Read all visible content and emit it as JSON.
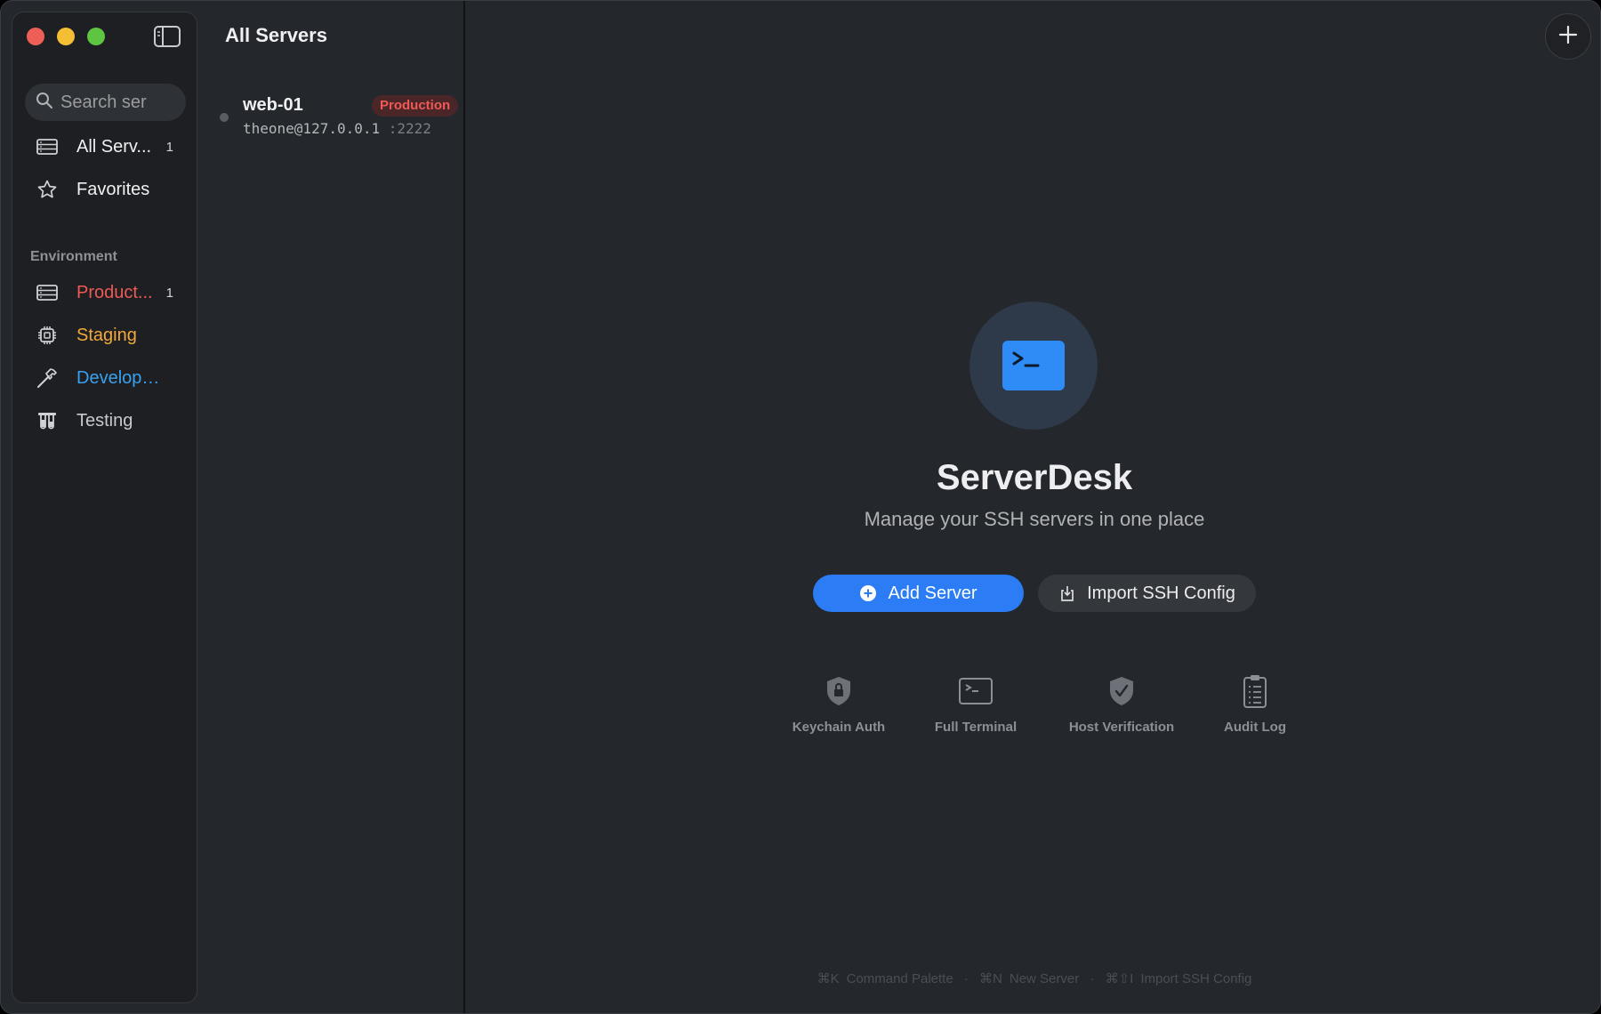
{
  "sidebar": {
    "search_placeholder": "Search ser",
    "items": [
      {
        "label": "All Serv...",
        "count": "1"
      },
      {
        "label": "Favorites"
      }
    ],
    "section_title": "Environment",
    "env_items": [
      {
        "label": "Product...",
        "count": "1",
        "color": "#ef5a55"
      },
      {
        "label": "Staging",
        "color": "#f2a93b"
      },
      {
        "label": "Developm...",
        "color": "#3aa0f0"
      },
      {
        "label": "Testing",
        "color": "#c8c9cc"
      }
    ]
  },
  "list": {
    "title": "All Servers",
    "servers": [
      {
        "name": "web-01",
        "badge": "Production",
        "address": "theone@127.0.0.1",
        "port": ":2222"
      }
    ]
  },
  "main": {
    "app_name": "ServerDesk",
    "tagline": "Manage your SSH servers in one place",
    "add_button": "Add Server",
    "import_button": "Import SSH Config",
    "features": [
      {
        "label": "Keychain Auth",
        "icon": "lock-shield-icon"
      },
      {
        "label": "Full Terminal",
        "icon": "terminal-icon"
      },
      {
        "label": "Host Verification",
        "icon": "check-shield-icon"
      },
      {
        "label": "Audit Log",
        "icon": "clipboard-list-icon"
      }
    ],
    "shortcuts": {
      "k1": "⌘K",
      "t1": "Command Palette",
      "sep": "·",
      "k2": "⌘N",
      "t2": "New Server",
      "k3": "⌘⇧I",
      "t3": "Import SSH Config"
    }
  },
  "colors": {
    "accent": "#2c7df5",
    "production": "#ef5a55",
    "staging": "#f2a93b",
    "development": "#3aa0f0"
  }
}
